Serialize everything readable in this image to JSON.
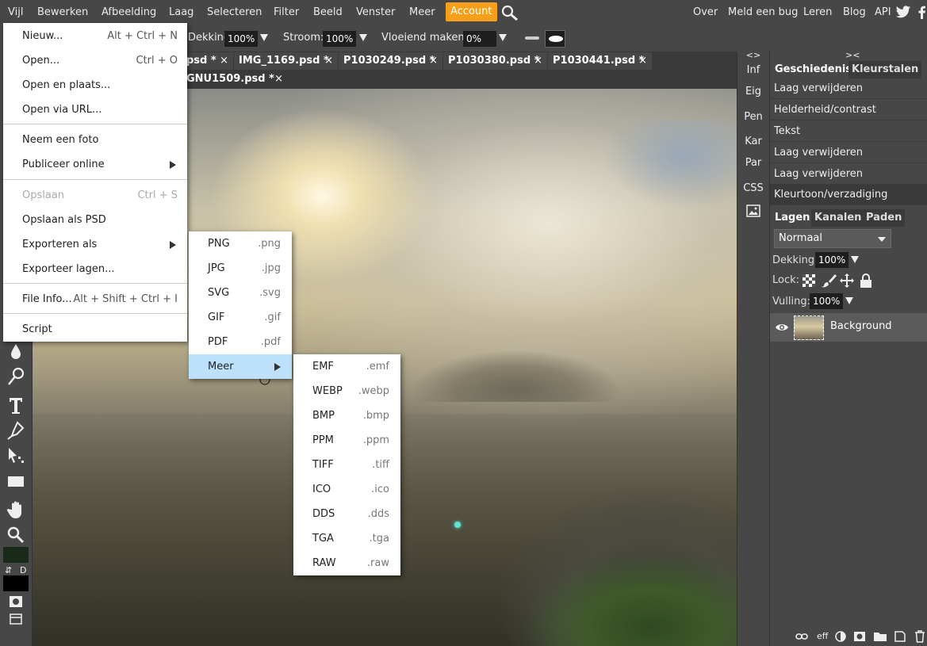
{
  "menubar": {
    "items": [
      "Vijl",
      "Bewerken",
      "Afbeelding",
      "Laag",
      "Selecteren",
      "Filter",
      "Beeld",
      "Venster",
      "Meer"
    ],
    "account": "Account",
    "right_items": [
      "Over",
      "Meld een bug",
      "Leren",
      "Blog",
      "API"
    ]
  },
  "options": {
    "opacity_label": "Dekking:",
    "opacity_value": "100%",
    "flow_label": "Stroom:",
    "flow_value": "100%",
    "smooth_label": "Vloeiend maken:",
    "smooth_value": "0%"
  },
  "tabs": [
    {
      "label": "psd *"
    },
    {
      "label": "IMG_1169.psd *"
    },
    {
      "label": "P1030249.psd *"
    },
    {
      "label": "P1030380.psd *"
    },
    {
      "label": "P1030441.psd *"
    },
    {
      "label": "GNU1509.psd *"
    }
  ],
  "tab_close": "×",
  "mini_panel": {
    "collapse": "<>",
    "items": [
      "Inf",
      "Eig",
      "Pen",
      "Kar",
      "Par",
      "CSS"
    ]
  },
  "right_panel": {
    "collapse": "><",
    "top_tabs": [
      "Geschiedenis",
      "Kleurstalen"
    ],
    "history": [
      "Laag verwijderen",
      "Helderheid/contrast",
      "Tekst",
      "Laag verwijderen",
      "Laag verwijderen",
      "Kleurtoon/verzadiging"
    ],
    "layer_tabs": [
      "Lagen",
      "Kanalen",
      "Paden"
    ],
    "blend_mode": "Normaal",
    "opacity_label": "Dekking:",
    "opacity_value": "100%",
    "lock_label": "Lock:",
    "fill_label": "Vulling:",
    "fill_value": "100%",
    "layer_name": "Background",
    "bottom_text": "eff"
  },
  "file_menu": {
    "items": [
      {
        "label": "Nieuw...",
        "shortcut": "Alt + Ctrl + N"
      },
      {
        "label": "Open...",
        "shortcut": "Ctrl + O"
      },
      {
        "label": "Open en plaats...",
        "shortcut": ""
      },
      {
        "label": "Open via URL...",
        "shortcut": ""
      },
      {
        "label": "Neem een foto",
        "shortcut": ""
      },
      {
        "label": "Publiceer online",
        "shortcut": ""
      },
      {
        "label": "Opslaan",
        "shortcut": "Ctrl + S",
        "disabled": true
      },
      {
        "label": "Opslaan als PSD",
        "shortcut": ""
      },
      {
        "label": "Exporteren als",
        "shortcut": ""
      },
      {
        "label": "Exporteer lagen...",
        "shortcut": ""
      },
      {
        "label": "File Info...",
        "shortcut": "Alt + Shift + Ctrl + I"
      },
      {
        "label": "Script",
        "shortcut": ""
      }
    ]
  },
  "export_menu": {
    "items": [
      {
        "label": "PNG",
        "ext": ".png"
      },
      {
        "label": "JPG",
        "ext": ".jpg"
      },
      {
        "label": "SVG",
        "ext": ".svg"
      },
      {
        "label": "GIF",
        "ext": ".gif"
      },
      {
        "label": "PDF",
        "ext": ".pdf"
      },
      {
        "label": "Meer",
        "ext": ""
      }
    ]
  },
  "more_menu": {
    "items": [
      {
        "label": "EMF",
        "ext": ".emf"
      },
      {
        "label": "WEBP",
        "ext": ".webp"
      },
      {
        "label": "BMP",
        "ext": ".bmp"
      },
      {
        "label": "PPM",
        "ext": ".ppm"
      },
      {
        "label": "TIFF",
        "ext": ".tiff"
      },
      {
        "label": "ICO",
        "ext": ".ico"
      },
      {
        "label": "DDS",
        "ext": ".dds"
      },
      {
        "label": "TGA",
        "ext": ".tga"
      },
      {
        "label": "RAW",
        "ext": ".raw"
      }
    ]
  },
  "toolbar": {
    "swap": "⇵",
    "default": "D"
  },
  "colors": {
    "menubar": "#474747",
    "account": "#f5a018",
    "highlight": "#bde0fb",
    "panel": "#474747",
    "tab_dark": "#3a3a3a"
  }
}
